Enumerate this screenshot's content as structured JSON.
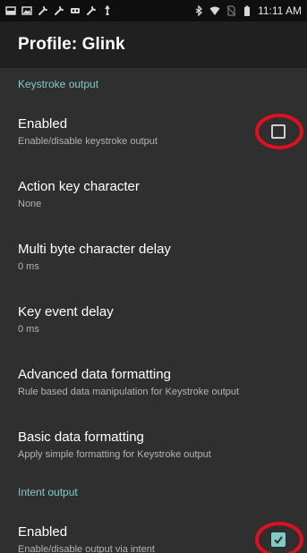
{
  "status_bar": {
    "time": "11:11 AM",
    "icons_left": [
      "screenshot-icon",
      "image-icon",
      "wrench-icon",
      "wrench-icon",
      "voicemail-icon",
      "wrench-icon",
      "usb-icon"
    ],
    "icons_right": [
      "bluetooth-icon",
      "wifi-icon",
      "no-sim-icon",
      "battery-icon"
    ]
  },
  "app_bar": {
    "title": "Profile: Glink"
  },
  "sections": {
    "keystroke_header": "Keystroke output",
    "intent_header": "Intent output"
  },
  "keystroke": {
    "enabled": {
      "title": "Enabled",
      "summary": "Enable/disable keystroke output",
      "checked": false
    },
    "action_key": {
      "title": "Action key character",
      "summary": "None"
    },
    "multibyte_delay": {
      "title": "Multi byte character delay",
      "summary": "0 ms"
    },
    "key_event_delay": {
      "title": "Key event delay",
      "summary": "0 ms"
    },
    "advanced_formatting": {
      "title": "Advanced data formatting",
      "summary": "Rule based data manipulation for Keystroke output"
    },
    "basic_formatting": {
      "title": "Basic data formatting",
      "summary": "Apply simple formatting for Keystroke output"
    }
  },
  "intent": {
    "enabled": {
      "title": "Enabled",
      "summary": "Enable/disable output via intent",
      "checked": true
    }
  },
  "colors": {
    "accent": "#80cbc4",
    "annotation": "#e01020",
    "background": "#2f2f2f",
    "app_bar": "#202020",
    "status_bar": "#0f0f0f"
  }
}
